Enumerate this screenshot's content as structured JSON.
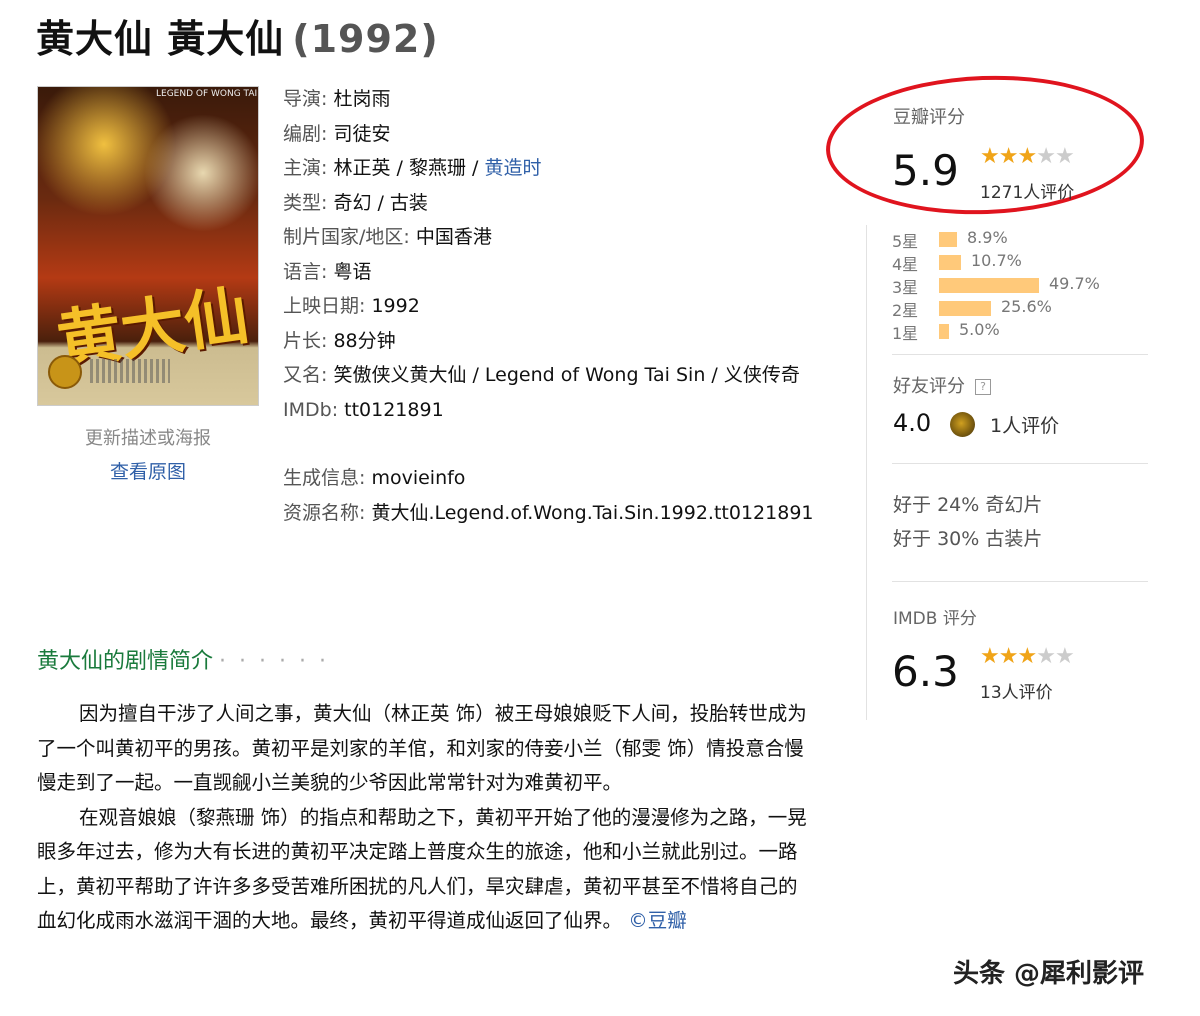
{
  "movie": {
    "title": "黄大仙 黃大仙",
    "year": "(1992)"
  },
  "poster": {
    "poster_text_en": "LEGEND OF WONG TAI SIN",
    "poster_text_cn": "黄大仙",
    "update_label": "更新描述或海报",
    "view_original": "查看原图"
  },
  "info": {
    "director_label": "导演:",
    "director": "杜岗雨",
    "writer_label": "编剧:",
    "writer": "司徒安",
    "cast_label": "主演:",
    "cast": [
      "林正英",
      "黎燕珊",
      "黄造时"
    ],
    "genre_label": "类型:",
    "genre": "奇幻 / 古装",
    "region_label": "制片国家/地区:",
    "region": "中国香港",
    "language_label": "语言:",
    "language": "粤语",
    "release_label": "上映日期:",
    "release": "1992",
    "runtime_label": "片长:",
    "runtime": "88分钟",
    "aka_label": "又名:",
    "aka": "笑傲侠义黄大仙 / Legend of Wong Tai Sin / 义侠传奇",
    "imdb_label": "IMDb:",
    "imdb": "tt0121891",
    "generated_label": "生成信息:",
    "generated": "movieinfo",
    "resource_label": "资源名称:",
    "resource": "黄大仙.Legend.of.Wong.Tai.Sin.1992.tt0121891"
  },
  "douban": {
    "header": "豆瓣评分",
    "score": "5.9",
    "stars": 3,
    "count": "1271人评价",
    "distribution": [
      {
        "label": "5星",
        "pct_text": "8.9%",
        "pct": 8.9
      },
      {
        "label": "4星",
        "pct_text": "10.7%",
        "pct": 10.7
      },
      {
        "label": "3星",
        "pct_text": "49.7%",
        "pct": 49.7
      },
      {
        "label": "2星",
        "pct_text": "25.6%",
        "pct": 25.6
      },
      {
        "label": "1星",
        "pct_text": "5.0%",
        "pct": 5.0
      }
    ]
  },
  "friends": {
    "header": "好友评分",
    "help_icon": "?",
    "score": "4.0",
    "count": "1人评价"
  },
  "better_than": [
    {
      "prefix": "好于",
      "pct": "24%",
      "genre": "奇幻片"
    },
    {
      "prefix": "好于",
      "pct": "30%",
      "genre": "古装片"
    }
  ],
  "imdb": {
    "header": "IMDB 评分",
    "score": "6.3",
    "stars": 3,
    "count": "13人评价"
  },
  "synopsis": {
    "header": "黄大仙的剧情简介",
    "dots": "· · · · · ·",
    "para1": "因为擅自干涉了人间之事，黄大仙（林正英 饰）被王母娘娘贬下人间，投胎转世成为了一个叫黄初平的男孩。黄初平是刘家的羊倌，和刘家的侍妾小兰（郁雯 饰）情投意合慢慢走到了一起。一直觊觎小兰美貌的少爷因此常常针对为难黄初平。",
    "para2": "在观音娘娘（黎燕珊 饰）的指点和帮助之下，黄初平开始了他的漫漫修为之路，一晃眼多年过去，修为大有长进的黄初平决定踏上普度众生的旅途，他和小兰就此别过。一路上，黄初平帮助了许许多多受苦难所困扰的凡人们，旱灾肆虐，黄初平甚至不惜将自己的血幻化成雨水滋润干涸的大地。最终，黄初平得道成仙返回了仙界。",
    "credit": "©豆瓣"
  },
  "watermark": "头条 @犀利影评",
  "colors": {
    "link": "#3060a8",
    "star": "#f0a418",
    "bar": "#ffc97a",
    "circle": "#e0141e",
    "synopsis_header": "#1a7a3c"
  }
}
